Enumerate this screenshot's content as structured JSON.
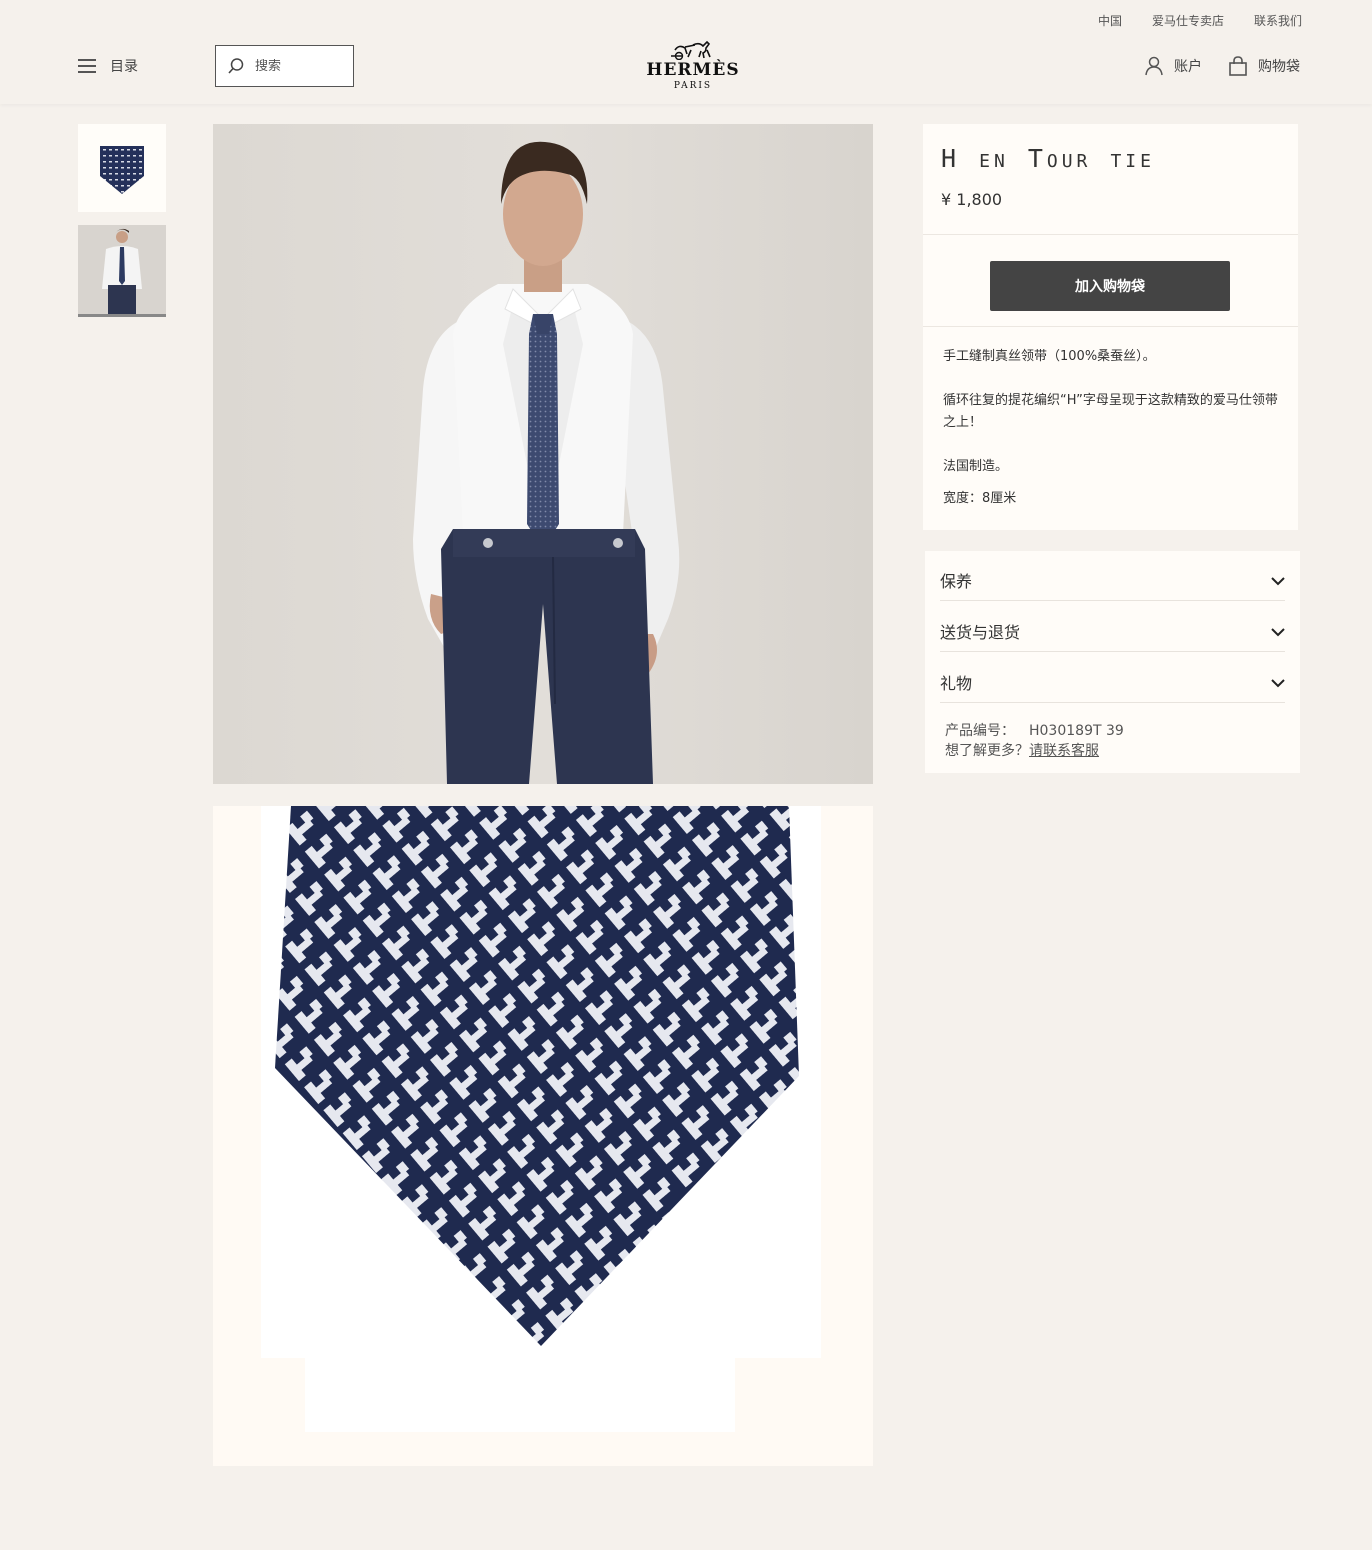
{
  "header": {
    "top_links": [
      "中国",
      "爱马仕专卖店",
      "联系我们"
    ],
    "menu_label": "目录",
    "search_placeholder": "搜索",
    "logo_main": "HERMÈS",
    "logo_sub": "PARIS",
    "account_label": "账户",
    "bag_label": "购物袋"
  },
  "product": {
    "title": "H en Tour tie",
    "price": "¥ 1,800",
    "add_to_bag": "加入购物袋",
    "description": [
      "手工缝制真丝领带（100%桑蚕丝）。",
      "循环往复的提花编织“H”字母呈现于这款精致的爱马仕领带之上！",
      "法国制造。",
      "宽度：8厘米"
    ]
  },
  "accordion": {
    "items": [
      "保养",
      "送货与退货",
      "礼物"
    ],
    "sku_label": "产品编号：",
    "sku_value": "H030189T 39",
    "help_text": "想了解更多？",
    "help_link": "请联系客服"
  },
  "colors": {
    "background": "#f5f1ec",
    "button": "#444444",
    "tie_navy": "#1f2a4f",
    "trouser_navy": "#2d3550"
  }
}
